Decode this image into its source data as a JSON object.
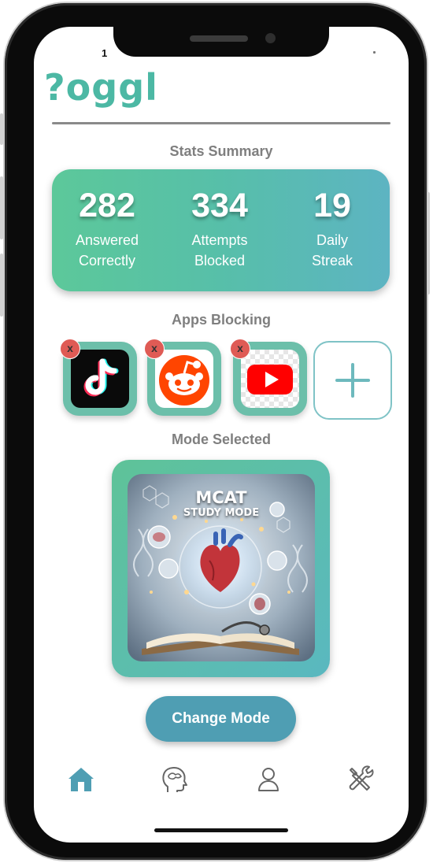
{
  "status_bar": {
    "left_text": "1"
  },
  "app": {
    "logo_text": "?oggl"
  },
  "stats": {
    "section_title": "Stats Summary",
    "items": [
      {
        "value": "282",
        "label_line1": "Answered",
        "label_line2": "Correctly"
      },
      {
        "value": "334",
        "label_line1": "Attempts",
        "label_line2": "Blocked"
      },
      {
        "value": "19",
        "label_line1": "Daily",
        "label_line2": "Streak"
      }
    ]
  },
  "apps_blocking": {
    "section_title": "Apps Blocking",
    "apps": [
      {
        "name": "TikTok",
        "icon": "tiktok-icon",
        "remove_glyph": "x"
      },
      {
        "name": "Reddit",
        "icon": "reddit-icon",
        "remove_glyph": "x"
      },
      {
        "name": "YouTube",
        "icon": "youtube-icon",
        "remove_glyph": "x"
      }
    ],
    "add_icon": "plus-icon"
  },
  "mode": {
    "section_title": "Mode Selected",
    "art_title_line1": "MCAT",
    "art_title_line2": "STUDY MODE",
    "change_button": "Change Mode"
  },
  "bottom_nav": [
    {
      "icon": "home-icon",
      "active": true
    },
    {
      "icon": "brain-head-icon",
      "active": false
    },
    {
      "icon": "profile-icon",
      "active": false
    },
    {
      "icon": "tools-icon",
      "active": false
    }
  ],
  "colors": {
    "brand": "#4cb8a4",
    "active_nav": "#4f9eb3",
    "inactive_nav": "#666666",
    "button": "#4f9eb3"
  }
}
